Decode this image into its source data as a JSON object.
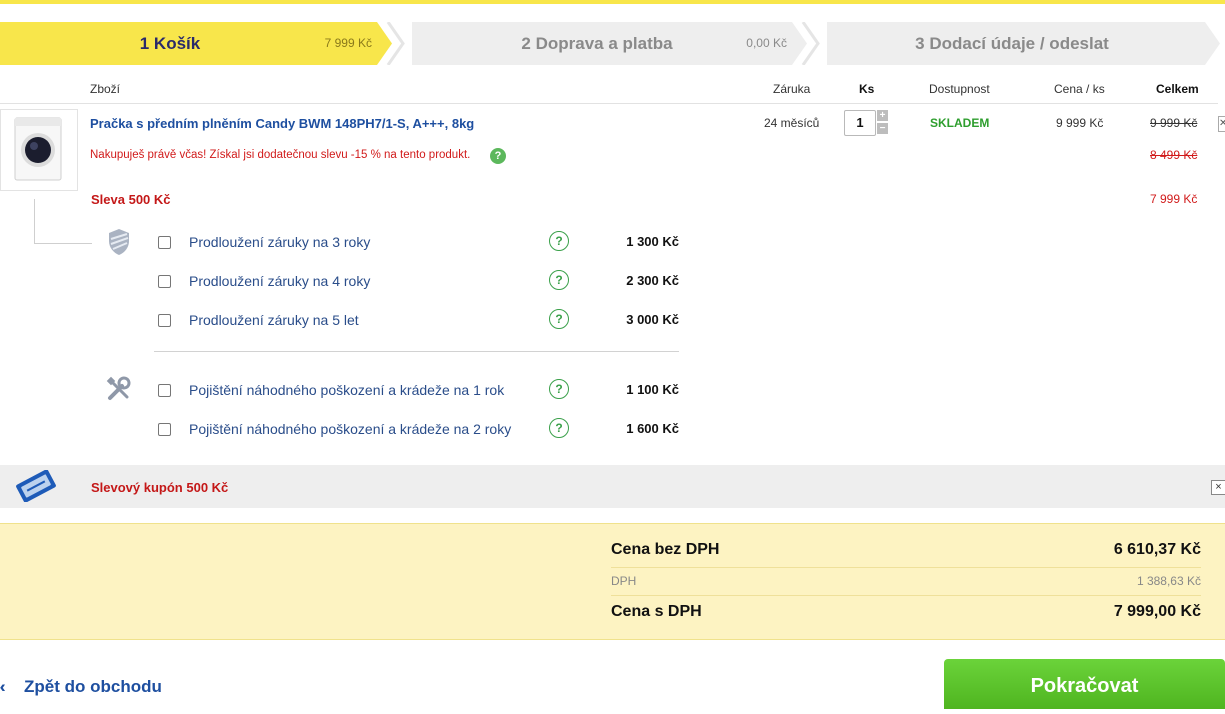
{
  "steps": [
    {
      "label": "1 Košík",
      "amount": "7 999 Kč"
    },
    {
      "label": "2 Doprava a platba",
      "amount": "0,00  Kč"
    },
    {
      "label": "3 Dodací údaje / odeslat"
    }
  ],
  "table_header": {
    "item": "Zboží",
    "warranty": "Záruka",
    "qty": "Ks",
    "availability": "Dostupnost",
    "unit_price": "Cena / ks",
    "total": "Celkem"
  },
  "product": {
    "name": "Pračka s předním plněním Candy BWM 148PH7/1-S, A+++, 8kg",
    "warranty": "24 měsíců",
    "qty": "1",
    "qty_plus": "+",
    "qty_minus": "−",
    "availability": "SKLADEM",
    "unit_price": "9 999 Kč",
    "total_original": "9 999 Kč",
    "total_discounted": "8 499 Kč",
    "total_final": "7 999 Kč",
    "promo_text": "Nakupuješ právě včas! Získal jsi dodatečnou slevu -15 % na tento produkt.",
    "promo_help": "?",
    "discount_label": "Sleva 500 Kč"
  },
  "warranty_options": [
    {
      "label": "Prodloužení záruky na 3 roky",
      "price": "1 300 Kč",
      "help": "?"
    },
    {
      "label": "Prodloužení záruky na 4 roky",
      "price": "2 300 Kč",
      "help": "?"
    },
    {
      "label": "Prodloužení záruky na 5 let",
      "price": "3 000 Kč",
      "help": "?"
    }
  ],
  "insurance_options": [
    {
      "label": "Pojištění náhodného poškození a krádeže na 1 rok",
      "price": "1 100 Kč",
      "help": "?"
    },
    {
      "label": "Pojištění náhodného poškození a krádeže na 2 roky",
      "price": "1 600 Kč",
      "help": "?"
    }
  ],
  "coupon": {
    "label": "Slevový kupón 500 Kč",
    "remove": "×"
  },
  "summary": {
    "without_vat_label": "Cena bez DPH",
    "without_vat_value": "6 610,37 Kč",
    "vat_label": "DPH",
    "vat_value": "1 388,63 Kč",
    "with_vat_label": "Cena s DPH",
    "with_vat_value": "7 999,00 Kč"
  },
  "footer": {
    "back_label": "Zpět do obchodu",
    "continue_label": "Pokračovat"
  },
  "colors": {
    "accent_yellow": "#f8e64b",
    "link_blue": "#1e4fa0",
    "stock_green": "#2e9e2e",
    "discount_red": "#c41818",
    "button_green": "#5cc22c"
  }
}
